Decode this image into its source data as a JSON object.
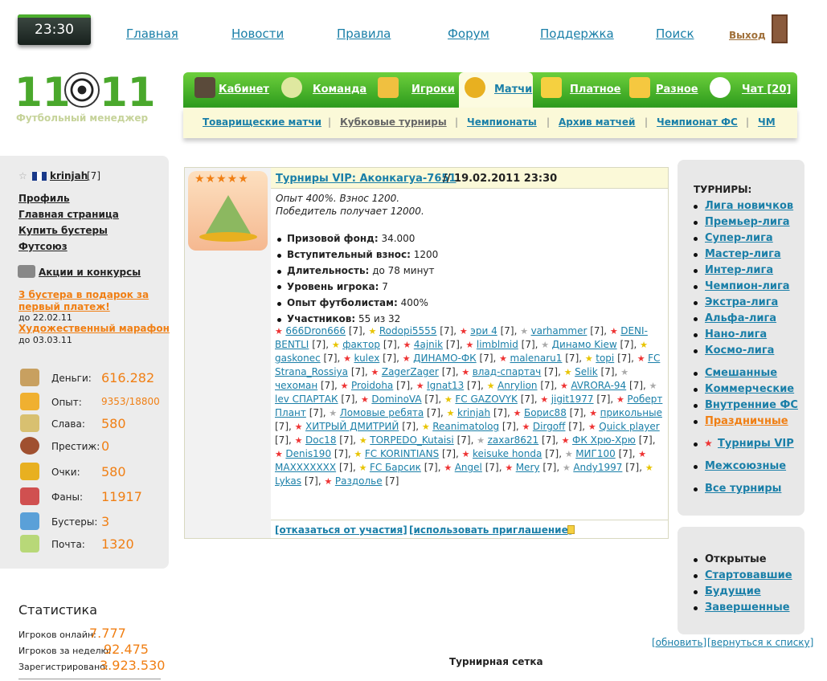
{
  "clock": "23:30",
  "topnav": [
    "Главная",
    "Новости",
    "Правила",
    "Форум",
    "Поддержка",
    "Поиск"
  ],
  "exit": "Выход",
  "logo": {
    "text": "11",
    "text2": "11",
    "sub": "Футбольный менеджер"
  },
  "mainnav": [
    "Кабинет",
    "Команда",
    "Игроки",
    "Матчи",
    "Платное",
    "Разное",
    "Чат [20]"
  ],
  "subnav": [
    "Товарищеские матчи",
    "Кубковые турниры",
    "Чемпионаты",
    "Архив матчей",
    "Чемпионат ФС",
    "ЧМ"
  ],
  "user": {
    "name": "krinjah",
    "level": "[7]"
  },
  "leftlinks": [
    "Профиль",
    "Главная страница",
    "Купить бустеры",
    "Футсоюз"
  ],
  "promo": {
    "title": "Акции и конкурсы",
    "item1": "3 бустера в подарок за первый платеж!",
    "date1": "до 22.02.11",
    "item2": "Художественный марафон",
    "date2": "до 03.03.11"
  },
  "stats": [
    {
      "label": "Деньги:",
      "value": "616.282"
    },
    {
      "label": "Опыт:",
      "value": "9353/18800"
    },
    {
      "label": "Слава:",
      "value": "580"
    },
    {
      "label": "Престиж:",
      "value": "0"
    },
    {
      "label": "Очки:",
      "value": "580"
    },
    {
      "label": "Фаны:",
      "value": "11917"
    },
    {
      "label": "Бустеры:",
      "value": "3"
    },
    {
      "label": "Почта:",
      "value": "1320"
    }
  ],
  "statistics": {
    "title": "Статистика",
    "online_label": "Игроков онлайн:",
    "online": "7.777",
    "week_label": "Игроков за неделю:",
    "week": "92.475",
    "reg_label": "Зарегистрировано:",
    "reg": "3.923.530"
  },
  "tournament": {
    "title_link": "Турниры VIP: Аконкагуа-7651",
    "title_date": "// 19.02.2011 23:30",
    "desc1": "Опыт 400%. Взнос 1200.",
    "desc2": "Победитель получает 12000.",
    "facts": [
      {
        "k": "Призовой фонд:",
        "v": "34.000"
      },
      {
        "k": "Вступительный взнос:",
        "v": "1200"
      },
      {
        "k": "Длительность:",
        "v": "до 78 минут"
      },
      {
        "k": "Уровень игрока:",
        "v": "7"
      },
      {
        "k": "Опыт футболистам:",
        "v": "400%"
      },
      {
        "k": "Участников:",
        "v": "55 из 32"
      }
    ],
    "players": [
      "666Dron666",
      "Rodopi5555",
      "эри 4",
      "varhammer",
      "DENI-BENTLI",
      "фактор",
      "4ajnik",
      "limblmid",
      "Динамо Kiew",
      "gaskonec",
      "kulex",
      "ДИНАМО-ФК",
      "malenaru1",
      "topi",
      "FC Strana_Rossiya",
      "ZagerZager",
      "влад-спартач",
      "Selik",
      "чехоман",
      "Proidoha",
      "Ignat13",
      "Anrylion",
      "AVRORA-94",
      "lev СПАРТАК",
      "DominoVA",
      "FC GAZOVYK",
      "jigit1977",
      "Роберт Плант",
      "Ломовые ребята",
      "krinjah",
      "Борис88",
      "прикольные",
      "ХИТРЫЙ ДМИТРИЙ",
      "Reanimatolog",
      "Dirgoff",
      "Quick player",
      "Doc18",
      "TORPEDO_Kutaisi",
      "zaxar8621",
      "ФК Хрю-Хрю",
      "Denis190",
      "FC KORINTIANS",
      "keisuke honda",
      "МИГ100",
      "MAXXXXXXX",
      "FC Барсик",
      "Angel",
      "Mery",
      "Andy1997",
      "Lykas",
      "Раздолье"
    ],
    "level_tag": "[7]",
    "footer1": "[отказаться от участия]",
    "footer2": "[использовать приглашение]"
  },
  "right": {
    "title": "ТУРНИРЫ:",
    "leagues": [
      "Лига новичков",
      "Премьер-лига",
      "Супер-лига",
      "Мастер-лига",
      "Интер-лига",
      "Чемпион-лига",
      "Экстра-лига",
      "Альфа-лига",
      "Нано-лига",
      "Космо-лига"
    ],
    "types": [
      "Смешанные",
      "Коммерческие",
      "Внутренние ФС",
      "Праздничные"
    ],
    "vip": "Турниры VIP",
    "inter": "Межсоюзные",
    "all": "Все турниры",
    "states": [
      "Открытые",
      "Стартовавшие",
      "Будущие",
      "Завершенные"
    ],
    "refresh": "[обновить]",
    "back": "[вернуться к списку]"
  },
  "grid_title": "Турнирная сетка"
}
